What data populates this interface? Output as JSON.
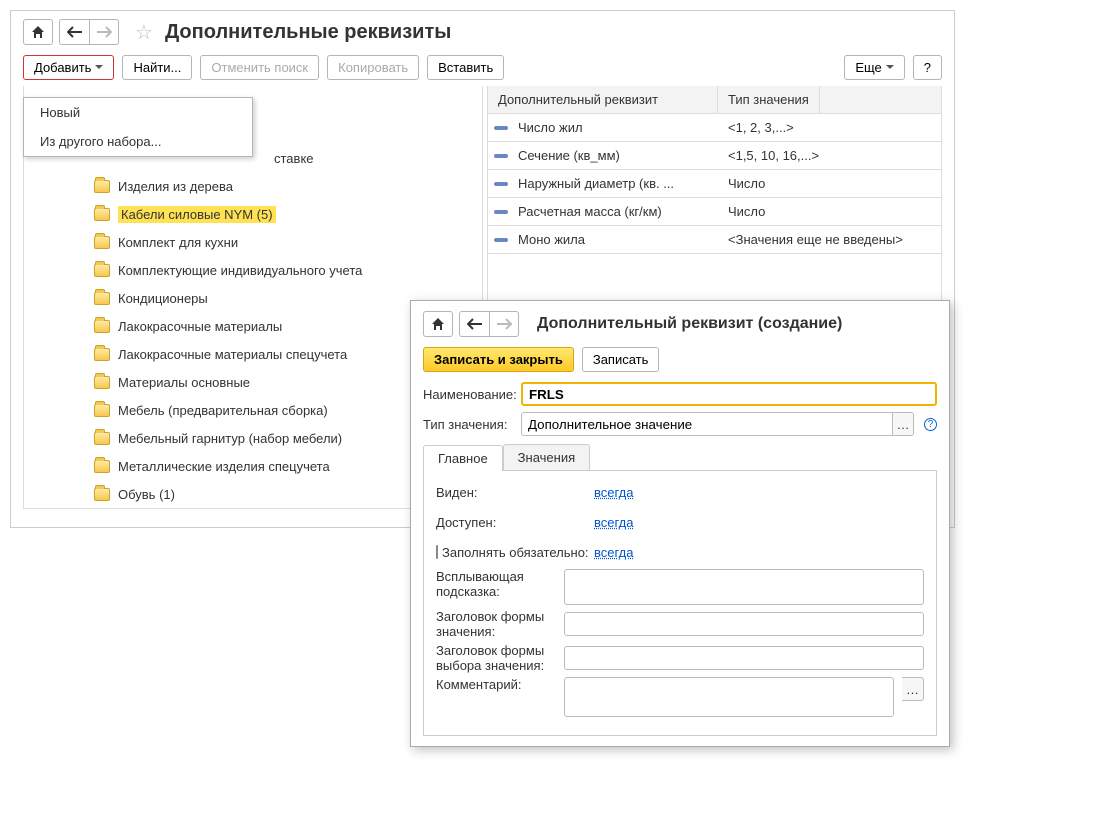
{
  "header": {
    "title": "Дополнительные реквизиты"
  },
  "toolbar": {
    "add": "Добавить",
    "find": "Найти...",
    "cancel_search": "Отменить поиск",
    "copy": "Копировать",
    "paste": "Вставить",
    "more": "Еще",
    "help": "?"
  },
  "add_menu": {
    "new_item": "Новый",
    "from_set": "Из другого набора..."
  },
  "tree": {
    "truncated_tail": "ставке",
    "items": [
      "Изделия из дерева",
      "Кабели силовые NYM (5)",
      "Комплект для кухни",
      "Комплектующие индивидуального учета",
      "Кондиционеры",
      "Лакокрасочные материалы",
      "Лакокрасочные материалы спецучета",
      "Материалы основные",
      "Мебель (предварительная сборка)",
      "Мебельный гарнитур (набор мебели)",
      "Металлические изделия спецучета",
      "Обувь (1)"
    ],
    "highlight_index": 1
  },
  "props_table": {
    "col1": "Дополнительный реквизит",
    "col2": "Тип значения",
    "rows": [
      {
        "name": "Число жил",
        "type": "<1, 2, 3,...>"
      },
      {
        "name": "Сечение (кв_мм)",
        "type": "<1,5, 10, 16,...>"
      },
      {
        "name": "Наружный диаметр (кв. ...",
        "type": "Число"
      },
      {
        "name": "Расчетная масса (кг/км)",
        "type": "Число"
      },
      {
        "name": "Моно жила",
        "type": "<Значения еще не введены>"
      }
    ]
  },
  "sub": {
    "title": "Дополнительный реквизит (создание)",
    "save_close": "Записать и закрыть",
    "save": "Записать",
    "name_label": "Наименование:",
    "name_value": "FRLS",
    "type_label": "Тип значения:",
    "type_value": "Дополнительное значение",
    "tabs": {
      "main": "Главное",
      "values": "Значения"
    },
    "visible_label": "Виден:",
    "visible_val": "всегда",
    "available_label": "Доступен:",
    "available_val": "всегда",
    "required_check": "Заполнять обязательно:",
    "required_val": "всегда",
    "tooltip_label": "Всплывающая подсказка:",
    "form_title_label": "Заголовок формы значения:",
    "form_select_label": "Заголовок формы выбора значения:",
    "comment_label": "Комментарий:"
  }
}
